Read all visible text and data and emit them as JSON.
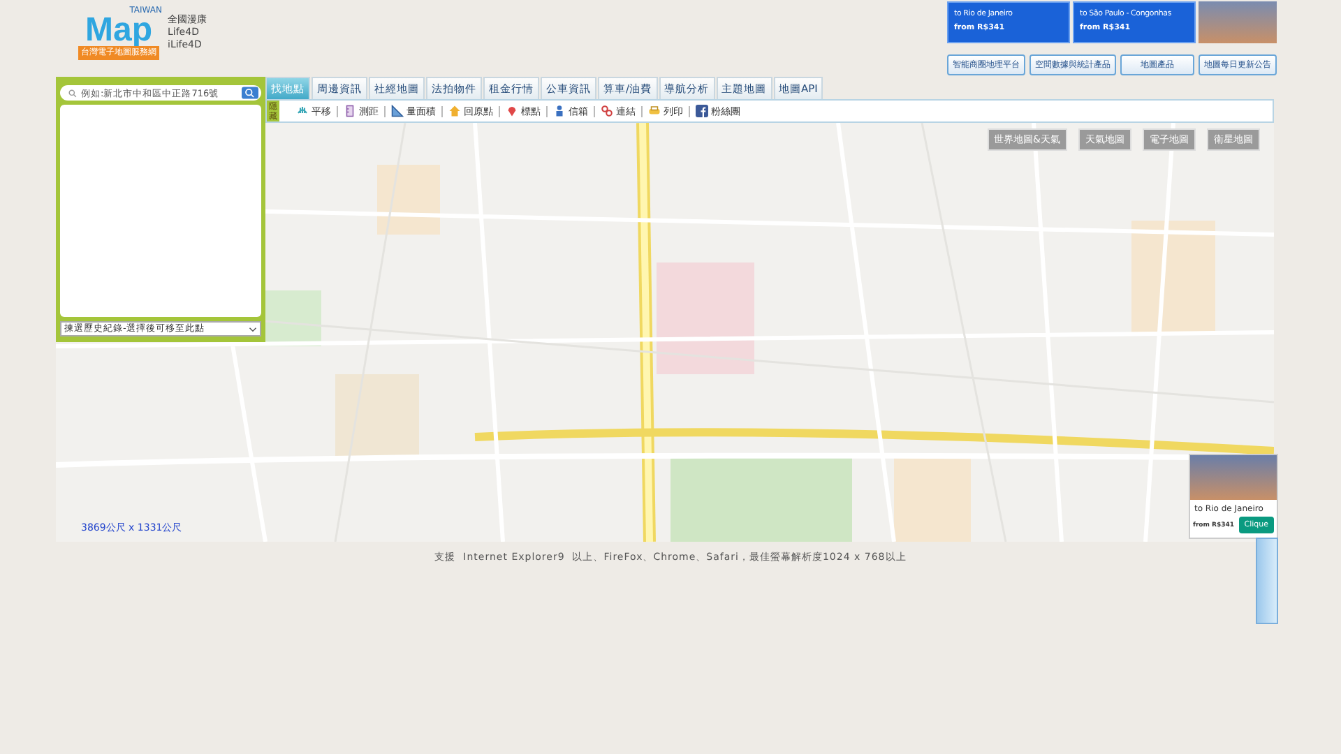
{
  "logo": {
    "word": "Map",
    "country": "TAIWAN",
    "tagline": "台灣電子地圖服務網"
  },
  "header_links": [
    "全國漫康",
    "Life4D",
    "iLife4D"
  ],
  "top_ads": [
    {
      "destination": "to Rio de Janeiro",
      "price": "from R$341"
    },
    {
      "destination": "to São Paulo - Congonhas",
      "price": "from R$341"
    }
  ],
  "top_buttons": [
    "智能商圈地理平台",
    "空間數據與統計產品",
    "地圖產品",
    "地圖每日更新公告"
  ],
  "search": {
    "placeholder": "例如:新北市中和區中正路716號"
  },
  "history_select": {
    "value": "揀選歷史紀錄-選擇後可移至此點"
  },
  "tabs": [
    {
      "label": "找地點",
      "selected": true
    },
    {
      "label": "周邊資訊",
      "selected": false
    },
    {
      "label": "社經地圖",
      "selected": false
    },
    {
      "label": "法拍物件",
      "selected": false
    },
    {
      "label": "租金行情",
      "selected": false
    },
    {
      "label": "公車資訊",
      "selected": false
    },
    {
      "label": "算車/油費",
      "selected": false
    },
    {
      "label": "導航分析",
      "selected": false
    },
    {
      "label": "主題地圖",
      "selected": false
    },
    {
      "label": "地圖API",
      "selected": false
    }
  ],
  "side_toggle": "隱藏",
  "tools": [
    {
      "kind": "hand",
      "label": "平移"
    },
    {
      "kind": "ruler",
      "label": "測距"
    },
    {
      "kind": "area",
      "label": "量面積"
    },
    {
      "kind": "home",
      "label": "回原點"
    },
    {
      "kind": "pin",
      "label": "標點"
    },
    {
      "kind": "person",
      "label": "信箱"
    },
    {
      "kind": "link",
      "label": "連結"
    },
    {
      "kind": "print",
      "label": "列印"
    },
    {
      "kind": "fb",
      "label": "粉絲團"
    }
  ],
  "map_types": [
    "世界地圖&天氣",
    "天氣地圖",
    "電子地圖",
    "衛星地圖"
  ],
  "map_scale": "3869公尺 x 1331公尺",
  "side_ad": {
    "destination": "to Rio de Janeiro",
    "price": "from R$341",
    "button": "Clique"
  },
  "footer": "支援  Internet Explorer9  以上、FireFox、Chrome、Safari，最佳螢幕解析度1024 x 768以上"
}
